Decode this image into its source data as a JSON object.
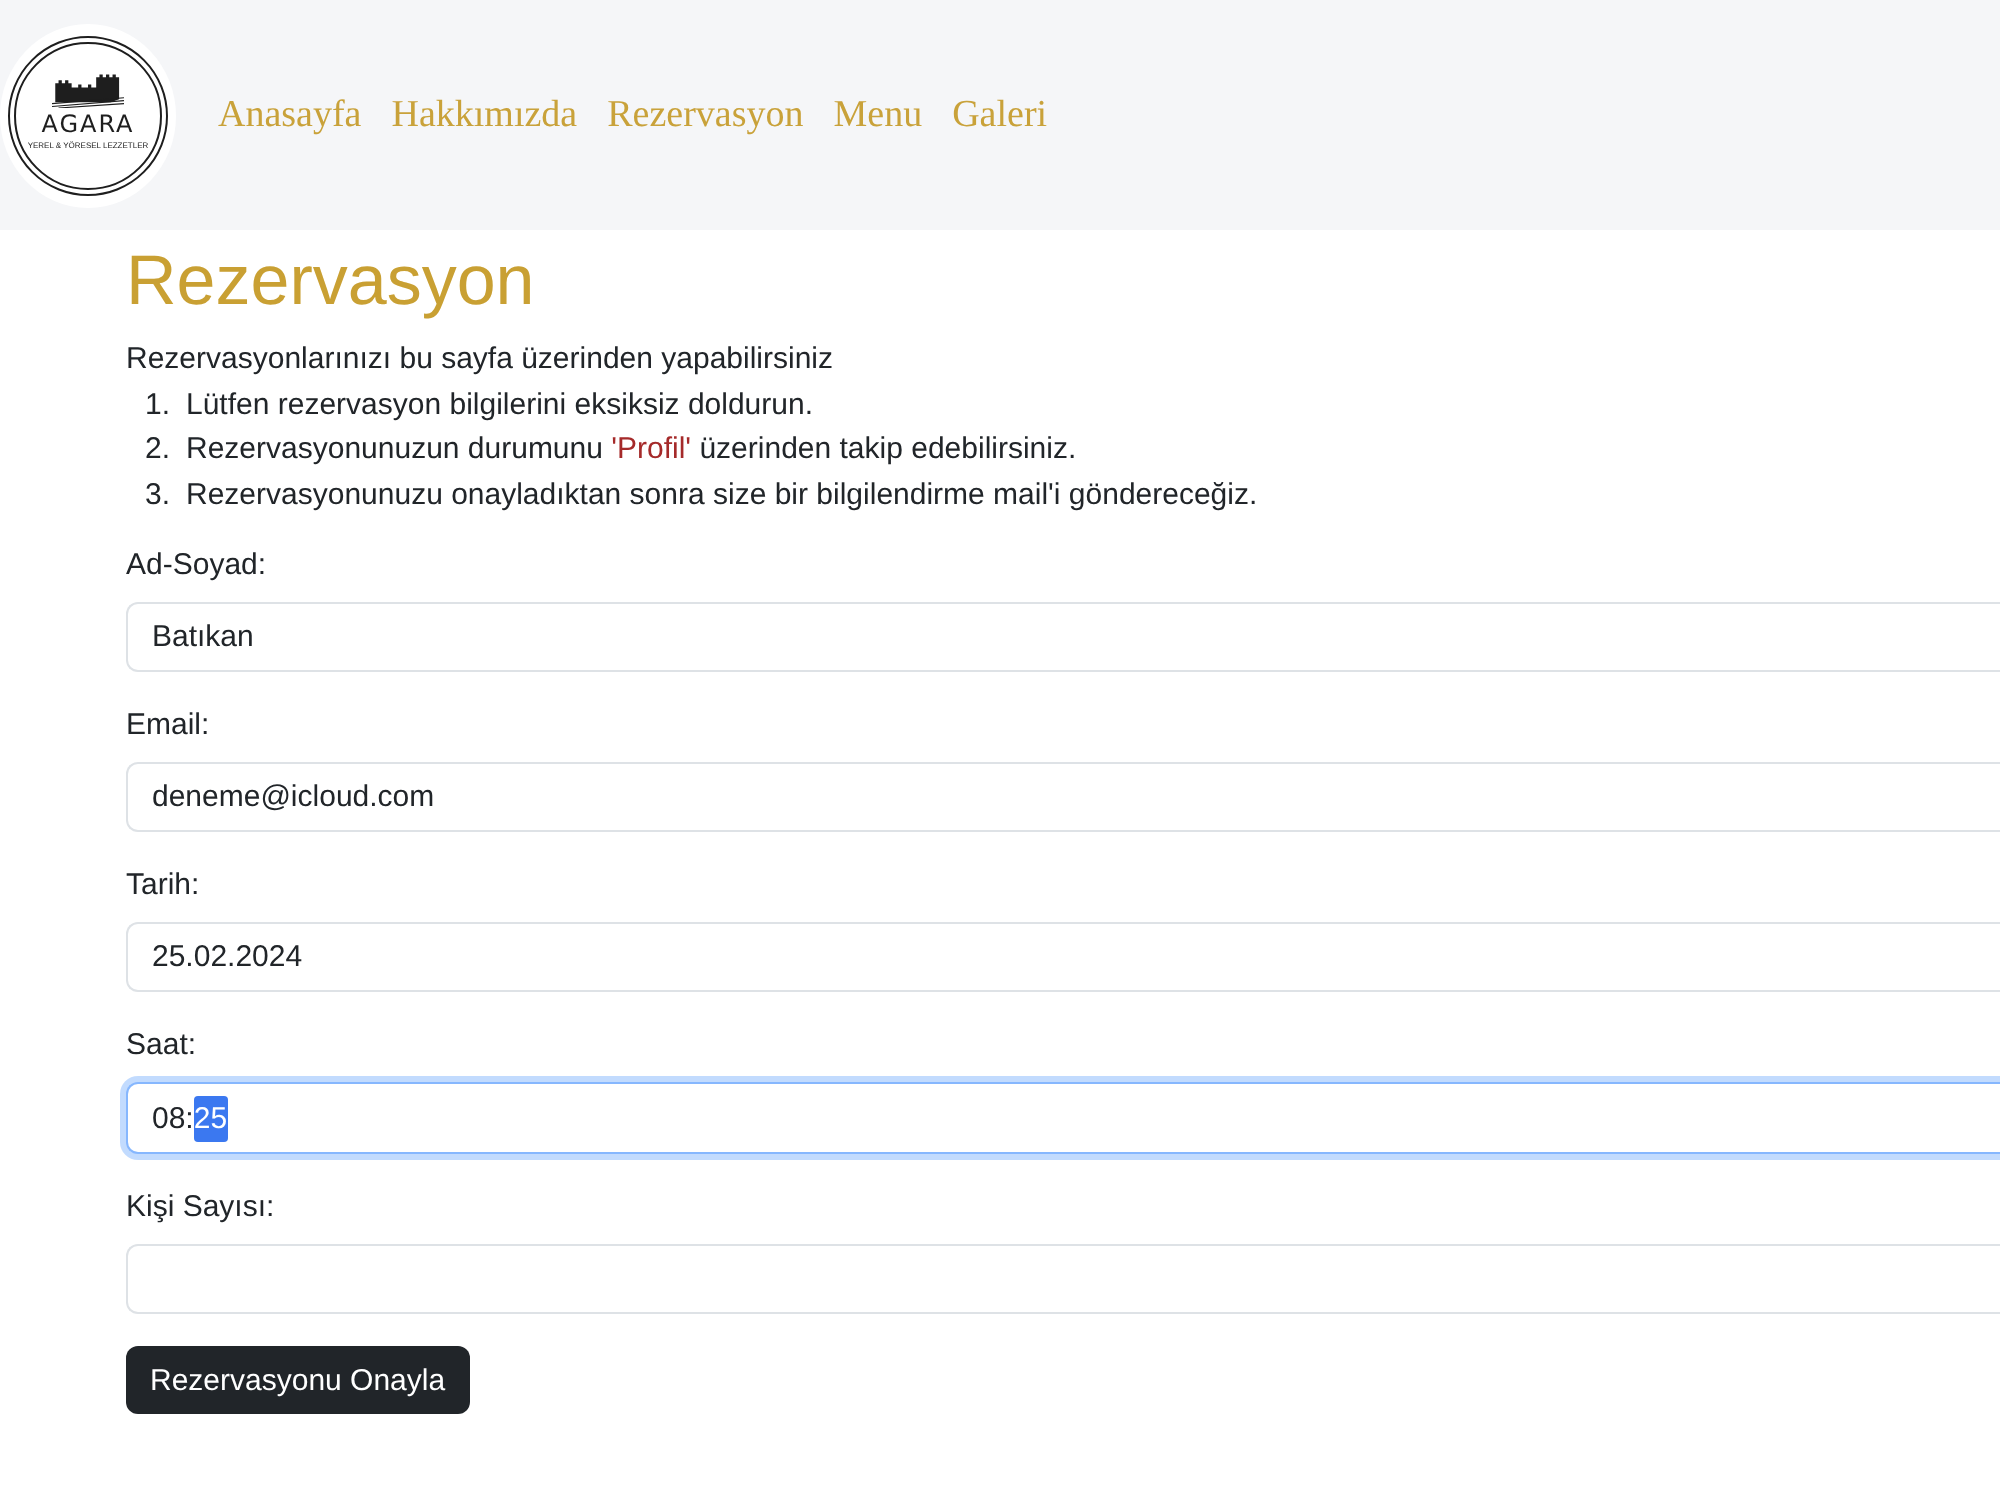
{
  "nav": {
    "logo": {
      "wordmark": "AGARA",
      "tagline": "YEREL & YÖRESEL LEZZETLER"
    },
    "links": [
      {
        "label": "Anasayfa"
      },
      {
        "label": "Hakkımızda"
      },
      {
        "label": "Rezervasyon"
      },
      {
        "label": "Menu"
      },
      {
        "label": "Galeri"
      }
    ]
  },
  "page": {
    "title": "Rezervasyon",
    "intro": "Rezervasyonlarınızı bu sayfa üzerinden yapabilirsiniz",
    "steps": [
      {
        "number": "1.",
        "parts": [
          {
            "text": "Lütfen rezervasyon bilgilerini eksiksiz doldurun.",
            "kind": "plain"
          }
        ]
      },
      {
        "number": "2.",
        "parts": [
          {
            "text": "Rezervasyonunuzun durumunu ",
            "kind": "plain"
          },
          {
            "text": "'Profil'",
            "kind": "link"
          },
          {
            "text": " üzerinden takip edebilirsiniz.",
            "kind": "plain"
          }
        ]
      },
      {
        "number": "3.",
        "parts": [
          {
            "text": "Rezervasyonunuzu onayladıktan sonra size bir bilgilendirme mail'i göndereceğiz.",
            "kind": "plain"
          }
        ]
      }
    ]
  },
  "form": {
    "fields": [
      {
        "label": "Ad-Soyad:",
        "kind": "text",
        "value": "Batıkan",
        "focused": false
      },
      {
        "label": "Email:",
        "kind": "text",
        "value": "deneme@icloud.com",
        "focused": false
      },
      {
        "label": "Tarih:",
        "kind": "text",
        "value": "25.02.2024",
        "focused": false
      },
      {
        "label": "Saat:",
        "kind": "time",
        "parts": [
          {
            "text": "08:",
            "selected": false
          },
          {
            "text": "25",
            "selected": true
          }
        ],
        "focused": true
      },
      {
        "label": "Kişi Sayısı:",
        "kind": "text",
        "focused": false
      }
    ],
    "submit": "Rezervasyonu Onayla"
  }
}
